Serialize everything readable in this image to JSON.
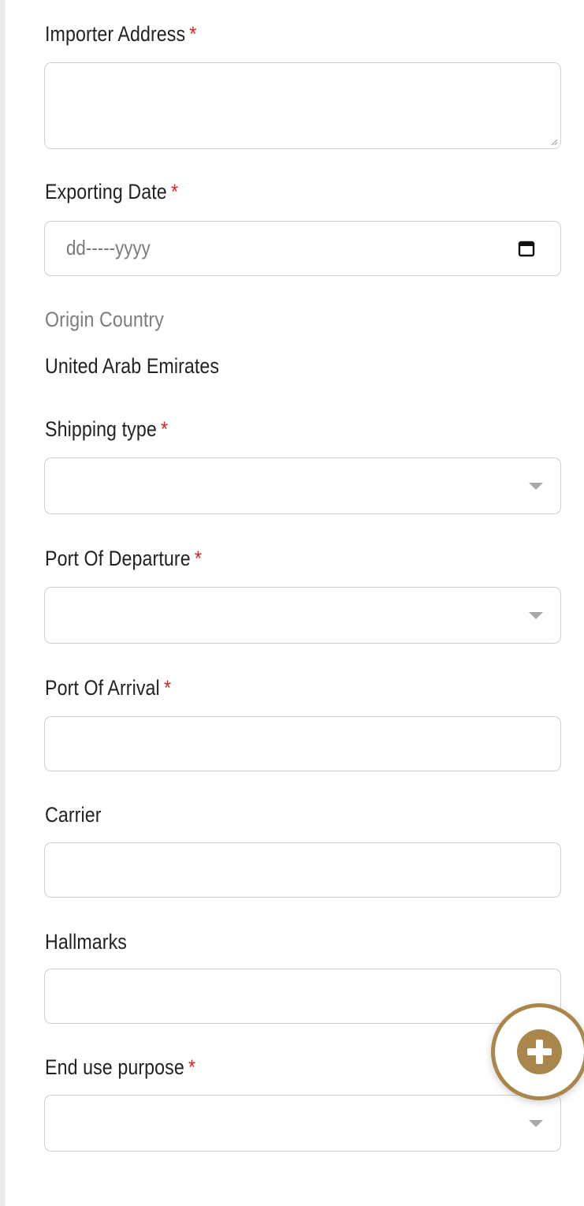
{
  "form": {
    "importer_address": {
      "label": "Importer Address",
      "required_mark": "*",
      "value": ""
    },
    "exporting_date": {
      "label": "Exporting Date",
      "required_mark": "*",
      "placeholder": "dd-----yyyy"
    },
    "origin_country": {
      "label": "Origin Country",
      "value": "United Arab Emirates"
    },
    "shipping_type": {
      "label": "Shipping type",
      "required_mark": "*",
      "selected": ""
    },
    "port_of_departure": {
      "label": "Port Of Departure",
      "required_mark": "*",
      "selected": ""
    },
    "port_of_arrival": {
      "label": "Port Of Arrival",
      "required_mark": "*",
      "value": ""
    },
    "carrier": {
      "label": "Carrier",
      "value": ""
    },
    "hallmarks": {
      "label": "Hallmarks",
      "value": ""
    },
    "end_use_purpose": {
      "label": "End use purpose",
      "required_mark": "*",
      "selected": ""
    }
  },
  "icons": {
    "date_picker": "calendar-icon",
    "dropdown": "chevron-down-icon",
    "fab": "plus-icon"
  },
  "colors": {
    "required": "#e02424",
    "accent": "#a9874c",
    "border": "#cfcfcf",
    "muted_label": "#7d7d7d"
  }
}
